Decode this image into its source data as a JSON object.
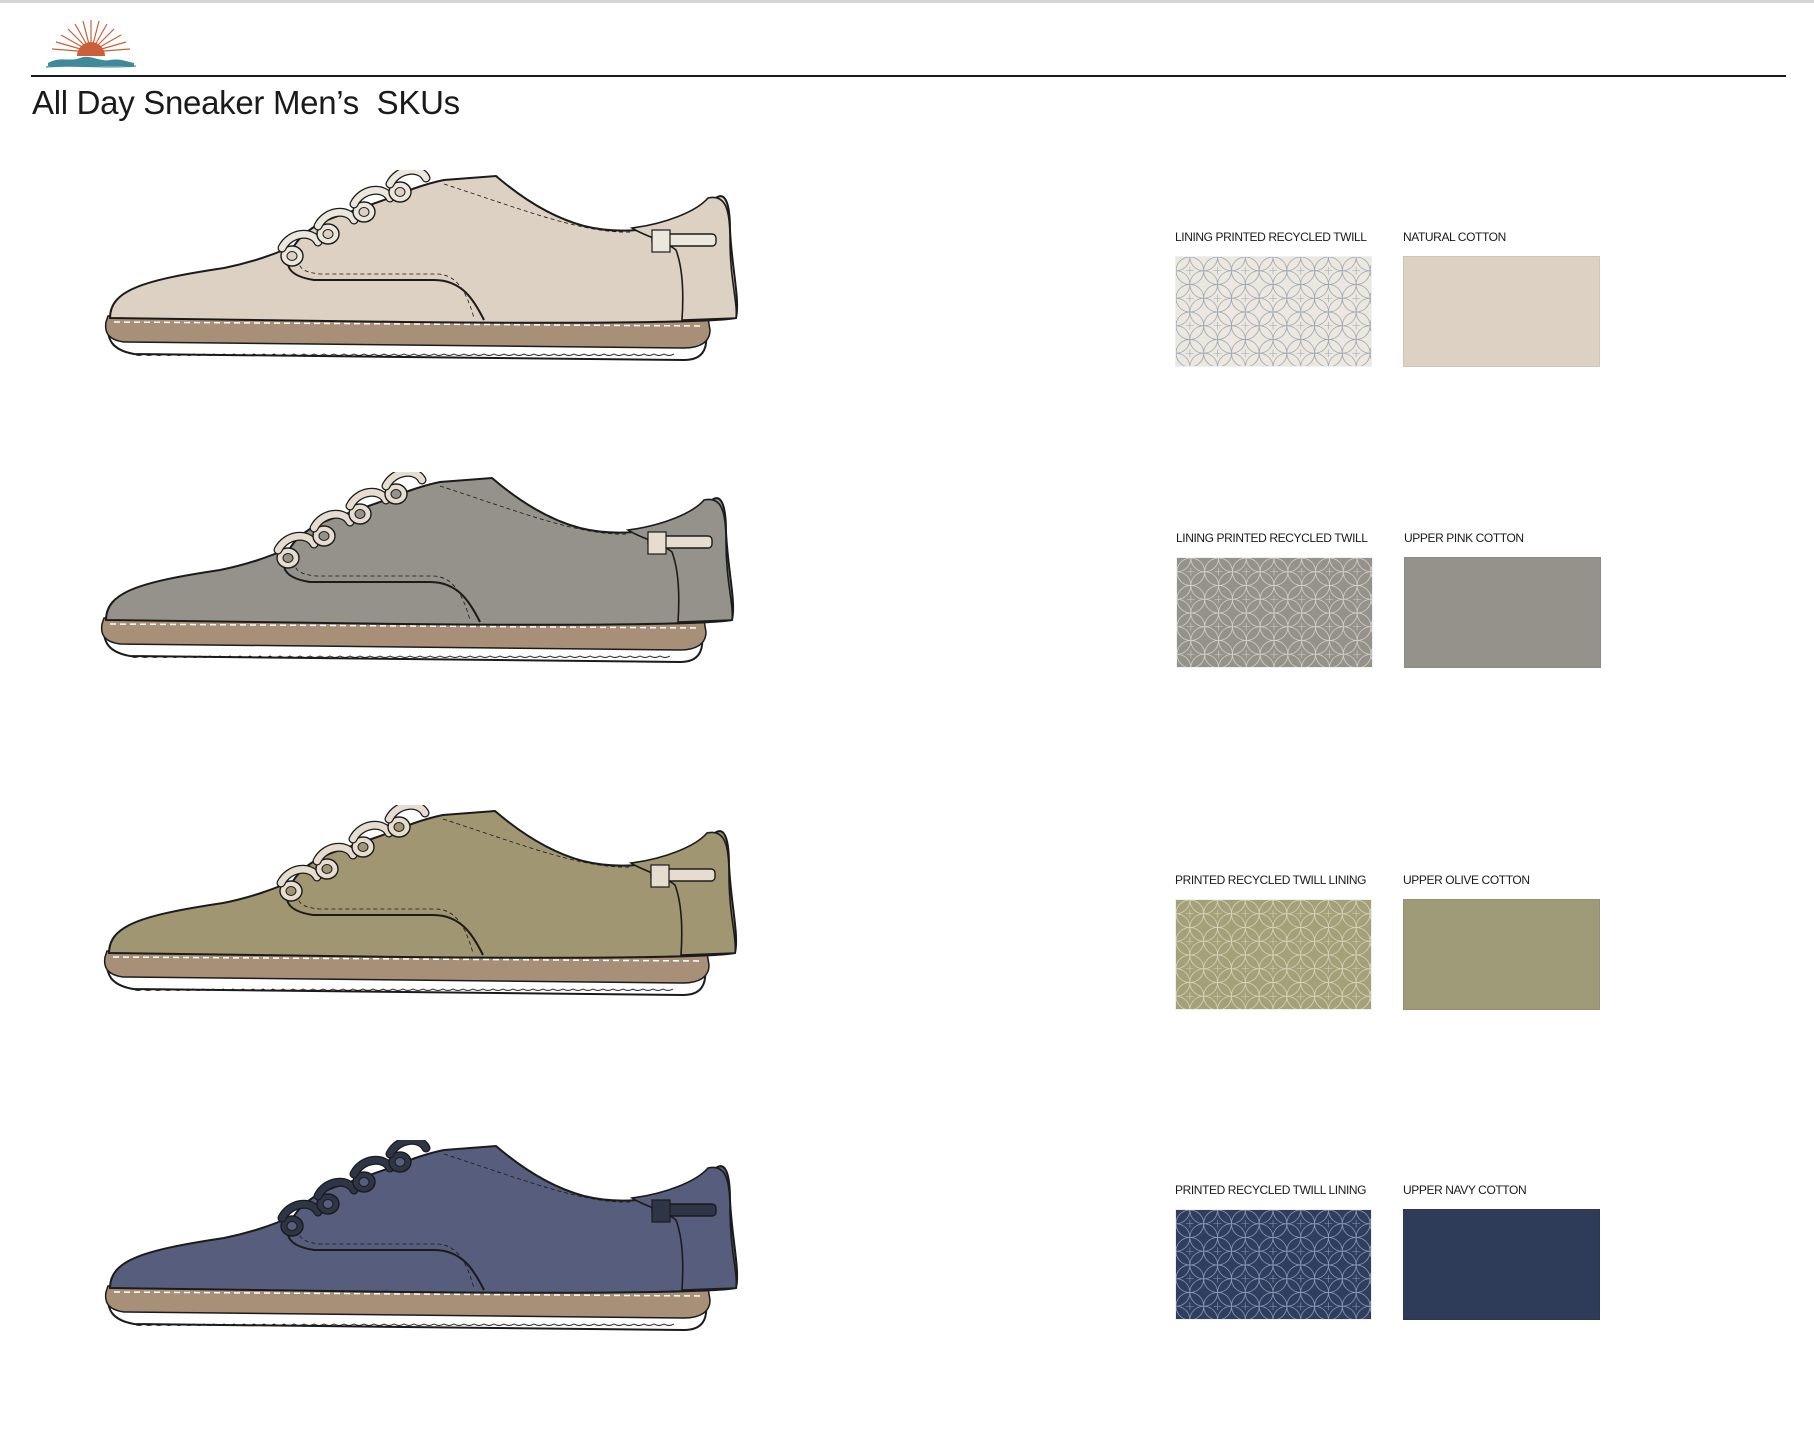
{
  "page": {
    "title": "All Day Sneaker Men’s  SKUs"
  },
  "colors": {
    "header_rule": "#1a1a1a",
    "logo_sun": "#c9603a",
    "logo_wave": "#3f8a9a"
  },
  "skus": [
    {
      "name": "natural",
      "upper_color": "#ddd1c3",
      "accent_color": "#ece7dc",
      "lining": {
        "label": "LINING PRINTED RECYCLED TWILL",
        "base_color": "#ece8df",
        "pattern_color": "#9aa4b4"
      },
      "upper": {
        "label": "NATURAL COTTON",
        "color": "#ddd1c3"
      }
    },
    {
      "name": "grey",
      "upper_color": "#95918b",
      "accent_color": "#e6ddd0",
      "lining": {
        "label": "LINING PRINTED RECYCLED TWILL",
        "base_color": "#95918b",
        "pattern_color": "#d7d2c9"
      },
      "upper": {
        "label": "UPPER PINK COTTON",
        "color": "#95918b"
      }
    },
    {
      "name": "olive",
      "upper_color": "#a09671",
      "accent_color": "#e6ddd0",
      "lining": {
        "label": "PRINTED RECYCLED TWILL LINING",
        "base_color": "#a3a07a",
        "pattern_color": "#d8d5bd"
      },
      "upper": {
        "label": "UPPER OLIVE COTTON",
        "color": "#9d9b78"
      }
    },
    {
      "name": "navy",
      "upper_color": "#575d7c",
      "accent_color": "#2e3547",
      "lining": {
        "label": "PRINTED RECYCLED TWILL LINING",
        "base_color": "#2f3e5e",
        "pattern_color": "#8e9bb8"
      },
      "upper": {
        "label": "UPPER NAVY COTTON",
        "color": "#2e3c59"
      }
    }
  ]
}
